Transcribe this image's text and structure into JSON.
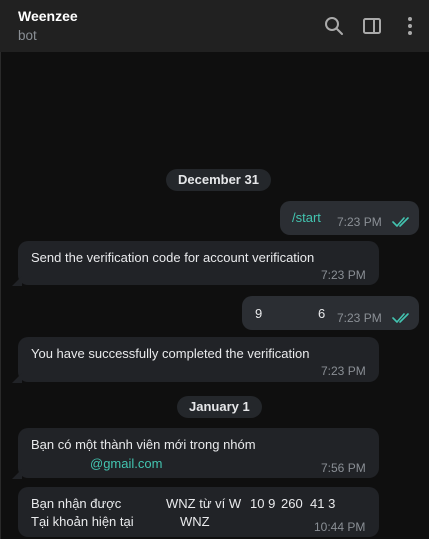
{
  "header": {
    "title": "Weenzee",
    "subtitle": "bot",
    "icons": [
      "search-icon",
      "sidebar-panel-icon",
      "more-vertical-icon"
    ]
  },
  "colors": {
    "accent": "#43c4b0",
    "background": "#0f0f0f",
    "bubble_in": "#212327",
    "bubble_out": "#2b2e33"
  },
  "dates": [
    "December 31",
    "January 1"
  ],
  "messages": [
    {
      "direction": "out",
      "text": "/start",
      "time": "7:23 PM",
      "read": true
    },
    {
      "direction": "in",
      "text": "Send the verification code for account verification",
      "time": "7:23 PM"
    },
    {
      "direction": "out",
      "text_left": "9",
      "text_right": "6",
      "time": "7:23 PM",
      "read": true
    },
    {
      "direction": "in",
      "text": "You have successfully completed the verification",
      "time": "7:23 PM"
    },
    {
      "direction": "in",
      "line1": "Bạn có một thành viên mới trong nhóm",
      "line2": "@gmail.com",
      "time": "7:56 PM"
    },
    {
      "direction": "in",
      "line1_a": "Bạn nhận được",
      "line1_b": "WNZ từ ví W",
      "line1_c": "10 9",
      "line1_d": "260",
      "line1_e": "41 3",
      "line2_a": "Tại khoản hiện tại",
      "line2_b": "WNZ",
      "time": "10:44 PM"
    }
  ]
}
